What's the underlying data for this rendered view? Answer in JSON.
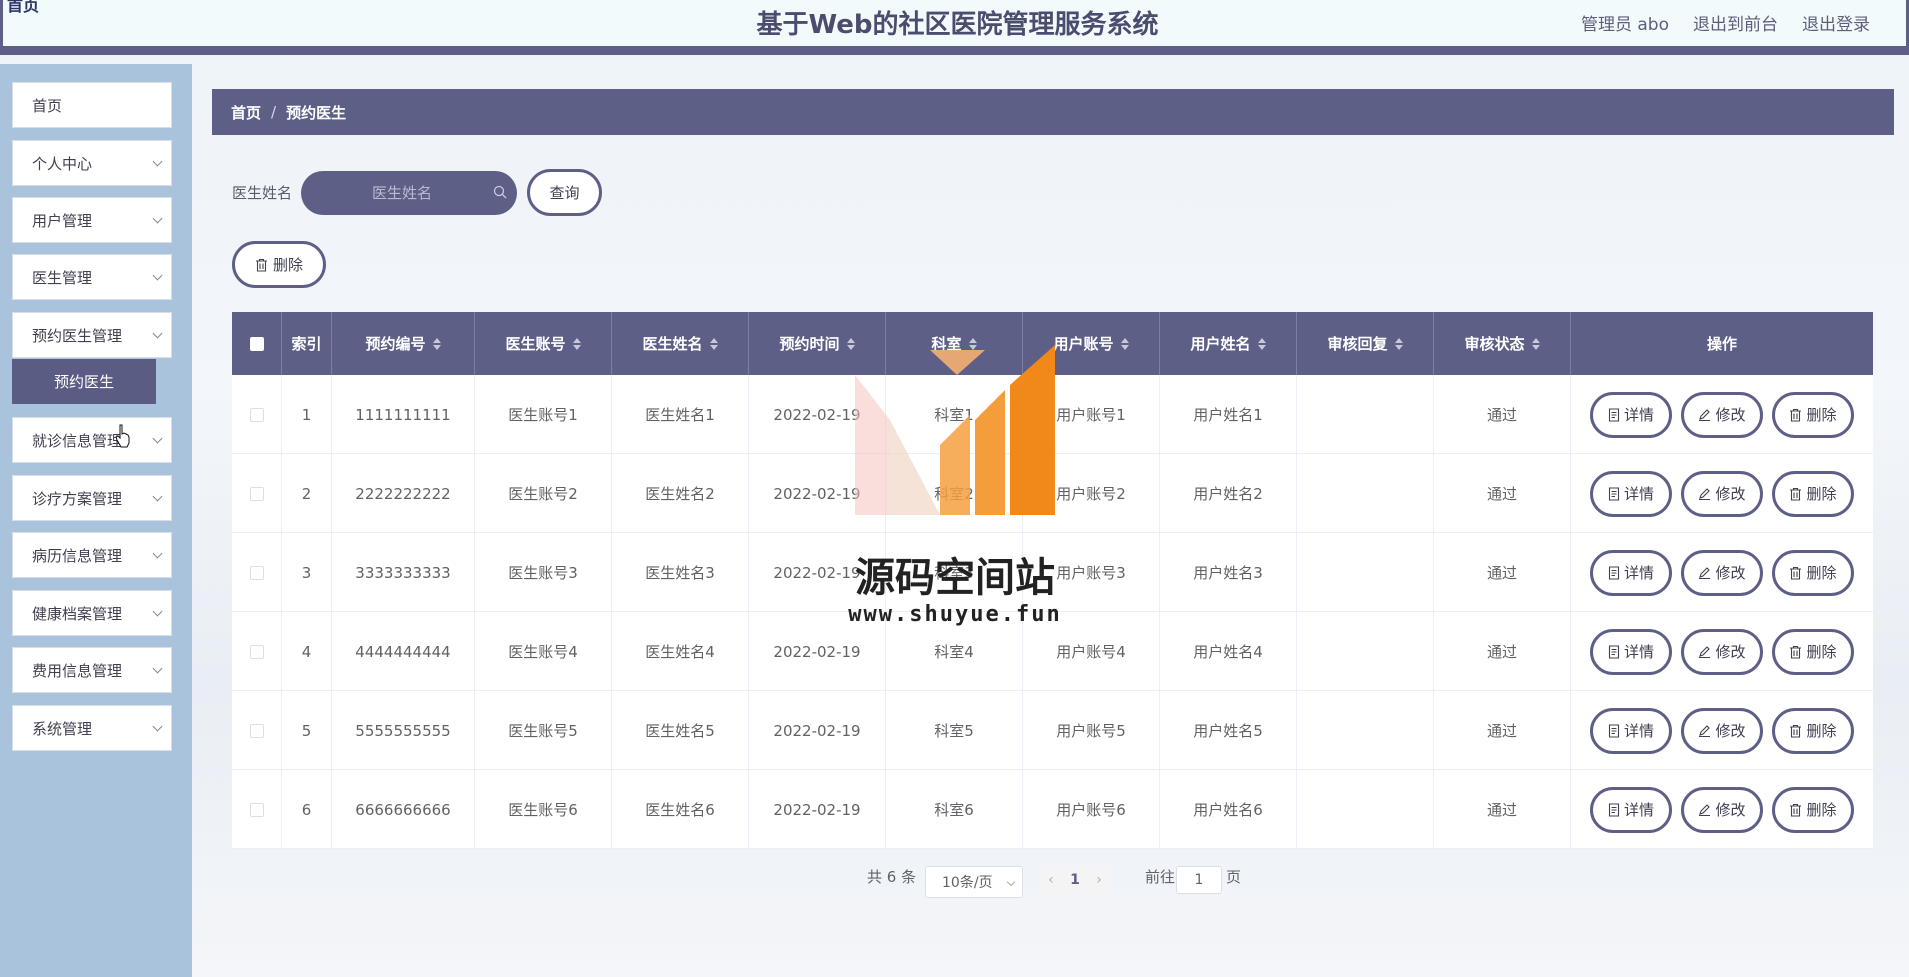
{
  "header": {
    "brand": "首页",
    "title": "基于Web的社区医院管理服务系统",
    "user": "管理员 abo",
    "to_front": "退出到前台",
    "logout": "退出登录"
  },
  "sidebar": {
    "items": [
      {
        "label": "首页",
        "expandable": false
      },
      {
        "label": "个人中心",
        "expandable": true
      },
      {
        "label": "用户管理",
        "expandable": true
      },
      {
        "label": "医生管理",
        "expandable": true
      },
      {
        "label": "预约医生管理",
        "expandable": true
      },
      {
        "label": "就诊信息管理",
        "expandable": true
      },
      {
        "label": "诊疗方案管理",
        "expandable": true
      },
      {
        "label": "病历信息管理",
        "expandable": true
      },
      {
        "label": "健康档案管理",
        "expandable": true
      },
      {
        "label": "费用信息管理",
        "expandable": true
      },
      {
        "label": "系统管理",
        "expandable": true
      }
    ],
    "active_sub": "预约医生"
  },
  "breadcrumb": {
    "home": "首页",
    "separator": "/",
    "current": "预约医生"
  },
  "search": {
    "label": "医生姓名",
    "placeholder": "医生姓名",
    "query_button": "查询"
  },
  "toolbar": {
    "delete_label": "删除"
  },
  "table": {
    "headers": [
      "索引",
      "预约编号",
      "医生账号",
      "医生姓名",
      "预约时间",
      "科室",
      "用户账号",
      "用户姓名",
      "审核回复",
      "审核状态",
      "操作"
    ],
    "actions": [
      "详情",
      "修改",
      "删除"
    ],
    "rows": [
      {
        "index": "1",
        "code": "1111111111",
        "doc_account": "医生账号1",
        "doc_name": "医生姓名1",
        "time": "2022-02-19",
        "dept": "科室1",
        "user_account": "用户账号1",
        "user_name": "用户姓名1",
        "reply": "",
        "status": "通过"
      },
      {
        "index": "2",
        "code": "2222222222",
        "doc_account": "医生账号2",
        "doc_name": "医生姓名2",
        "time": "2022-02-19",
        "dept": "科室2",
        "user_account": "用户账号2",
        "user_name": "用户姓名2",
        "reply": "",
        "status": "通过"
      },
      {
        "index": "3",
        "code": "3333333333",
        "doc_account": "医生账号3",
        "doc_name": "医生姓名3",
        "time": "2022-02-19",
        "dept": "科室3",
        "user_account": "用户账号3",
        "user_name": "用户姓名3",
        "reply": "",
        "status": "通过"
      },
      {
        "index": "4",
        "code": "4444444444",
        "doc_account": "医生账号4",
        "doc_name": "医生姓名4",
        "time": "2022-02-19",
        "dept": "科室4",
        "user_account": "用户账号4",
        "user_name": "用户姓名4",
        "reply": "",
        "status": "通过"
      },
      {
        "index": "5",
        "code": "5555555555",
        "doc_account": "医生账号5",
        "doc_name": "医生姓名5",
        "time": "2022-02-19",
        "dept": "科室5",
        "user_account": "用户账号5",
        "user_name": "用户姓名5",
        "reply": "",
        "status": "通过"
      },
      {
        "index": "6",
        "code": "6666666666",
        "doc_account": "医生账号6",
        "doc_name": "医生姓名6",
        "time": "2022-02-19",
        "dept": "科室6",
        "user_account": "用户账号6",
        "user_name": "用户姓名6",
        "reply": "",
        "status": "通过"
      }
    ]
  },
  "pagination": {
    "total": "共 6 条",
    "page_size": "10条/页",
    "current_page": "1",
    "goto_label": "前往",
    "goto_value": "1",
    "page_unit": "页"
  },
  "watermark": {
    "text": "源码空间站",
    "url": "www.shuyue.fun"
  },
  "colors": {
    "primary": "#5d5f86",
    "sidebar": "#a9c3dd",
    "watermark_orange": "#f0881a"
  }
}
